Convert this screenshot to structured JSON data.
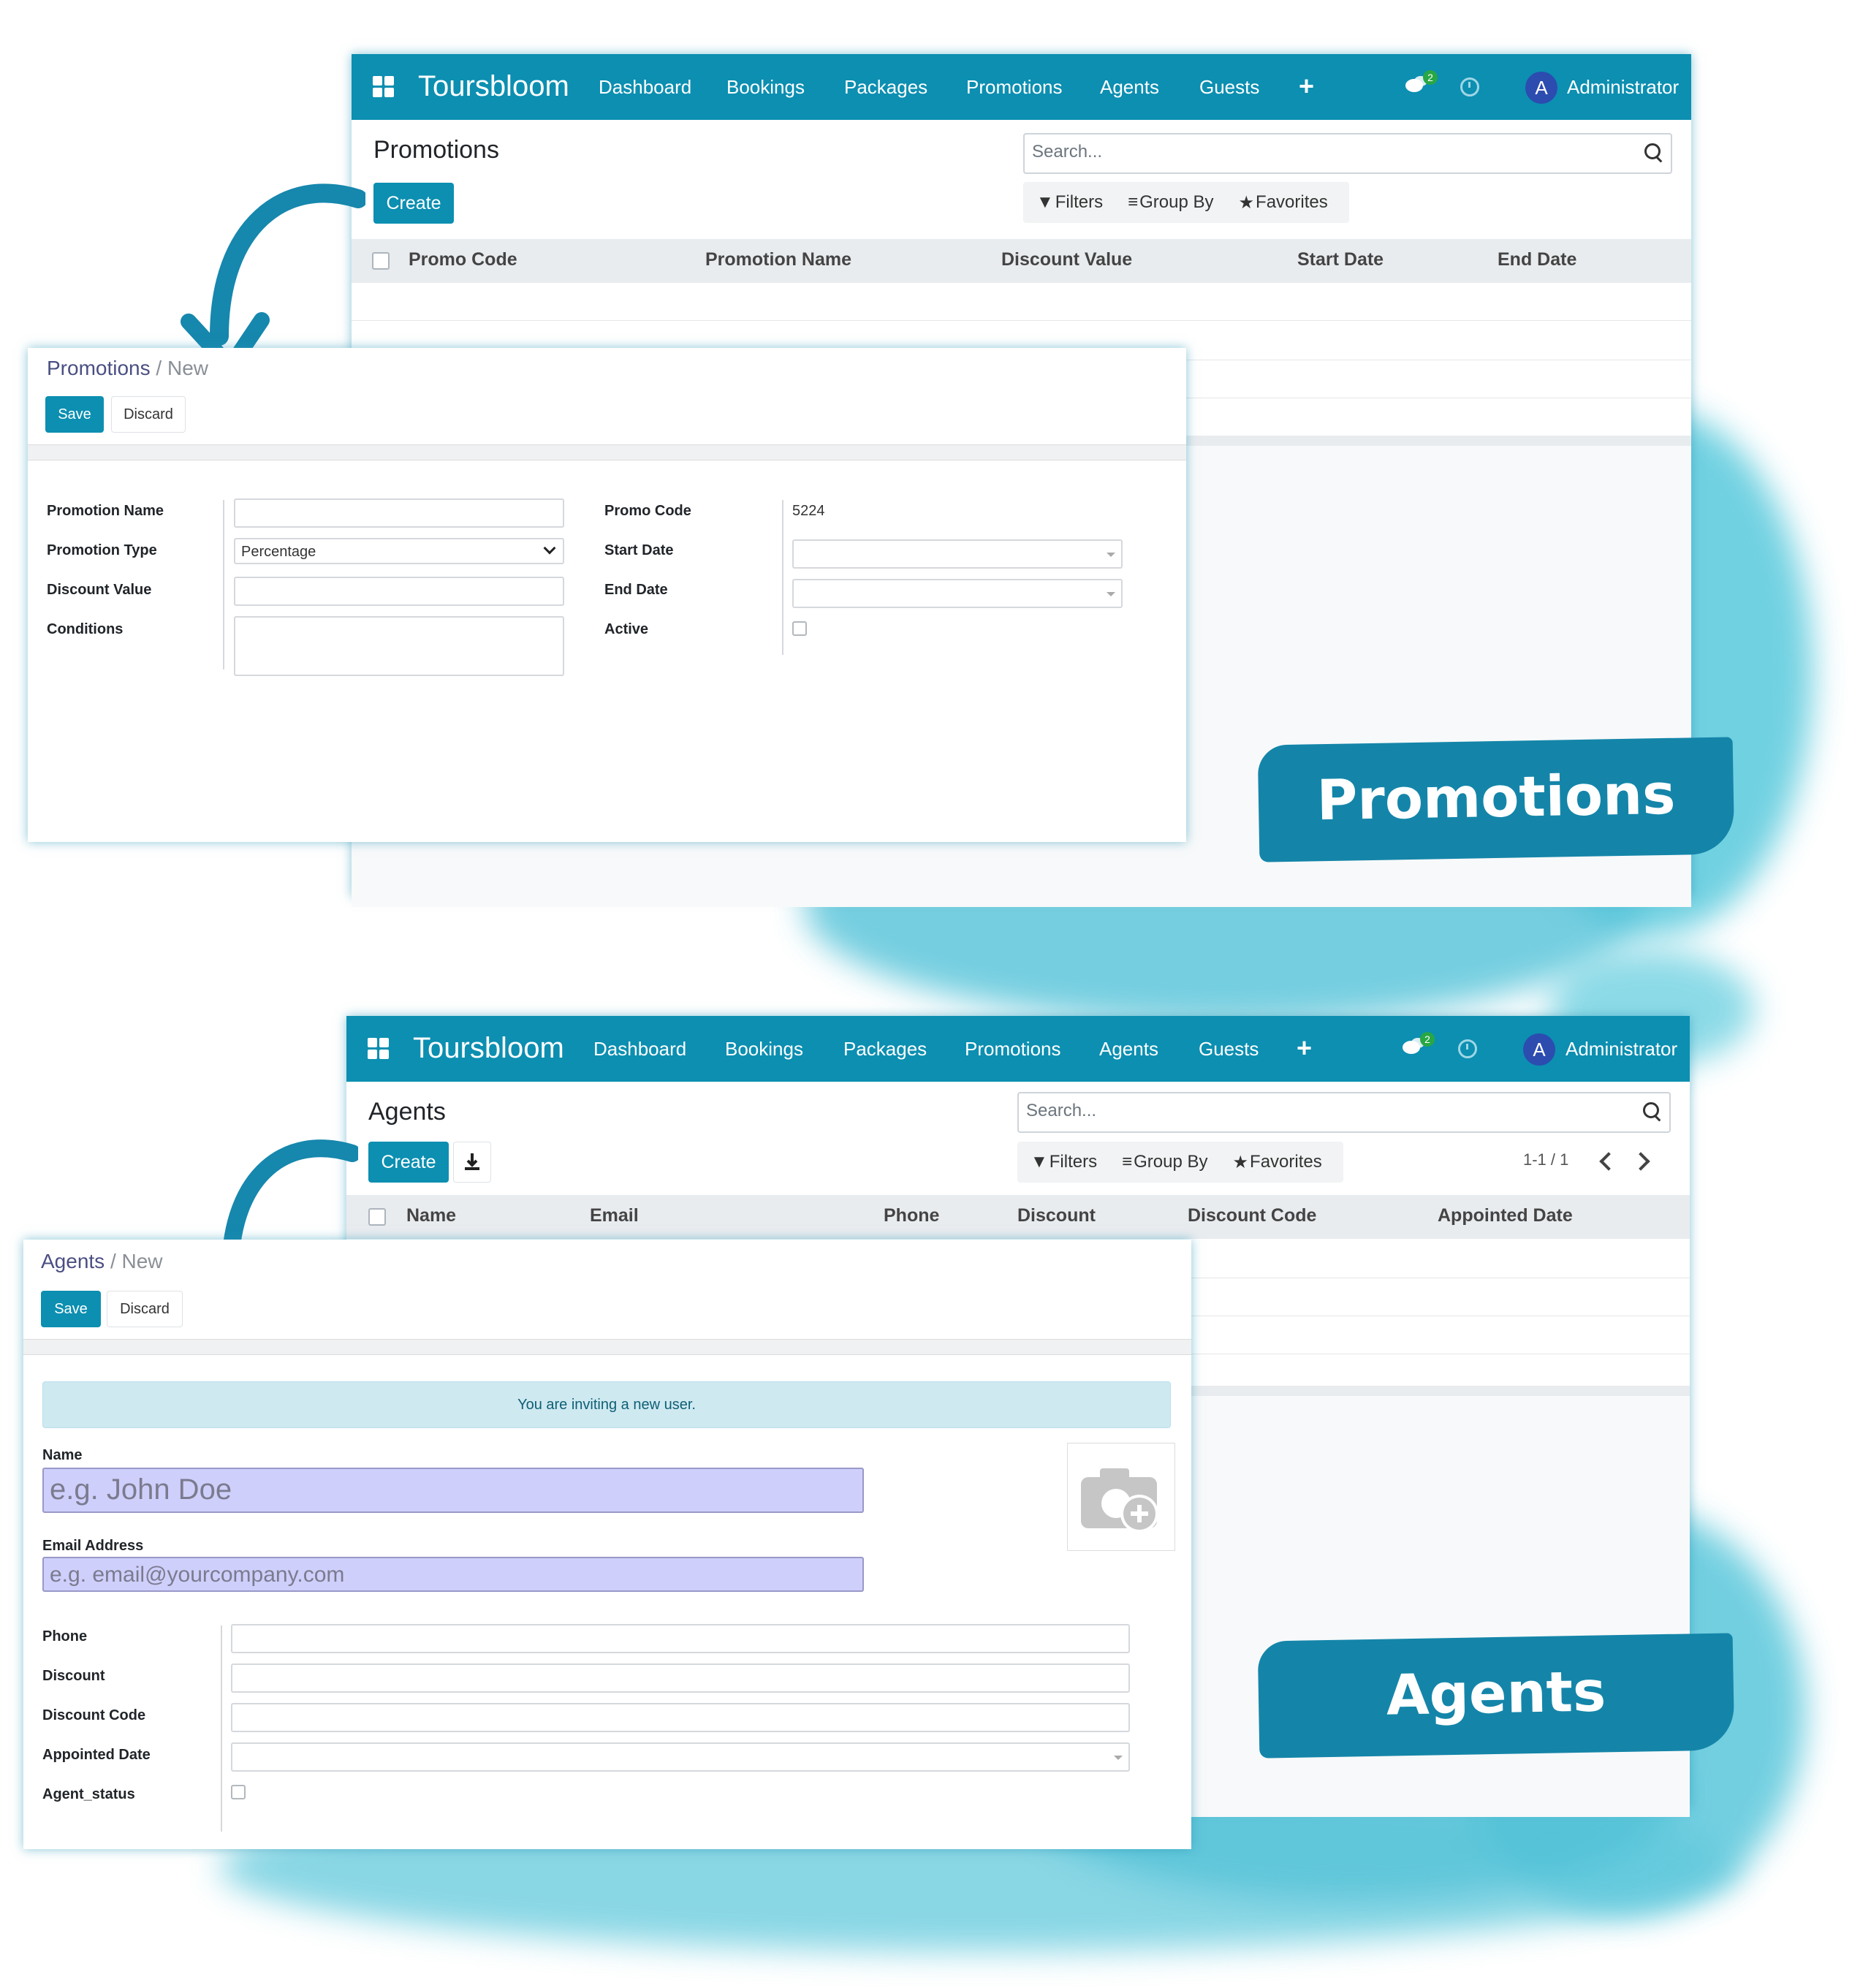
{
  "colors": {
    "brand": "#0c8fb1",
    "banner": "#1485a9",
    "splash": "#4cc6da"
  },
  "app": {
    "name": "Toursbloom",
    "nav_items": [
      "Dashboard",
      "Bookings",
      "Packages",
      "Promotions",
      "Agents",
      "Guests"
    ],
    "chat_count": "2",
    "avatar_initial": "A",
    "user": "Administrator"
  },
  "search": {
    "placeholder": "Search..."
  },
  "filters": {
    "filters": "Filters",
    "group_by": "Group By",
    "favorites": "Favorites"
  },
  "promotions_list": {
    "title": "Promotions",
    "create": "Create",
    "columns": [
      "Promo Code",
      "Promotion Name",
      "Discount Value",
      "Start Date",
      "End Date"
    ]
  },
  "promotion_form": {
    "breadcrumb_parent": "Promotions",
    "breadcrumb_sep": "/",
    "breadcrumb_current": "New",
    "save": "Save",
    "discard": "Discard",
    "labels": {
      "promotion_name": "Promotion Name",
      "promotion_type": "Promotion Type",
      "discount_value": "Discount Value",
      "conditions": "Conditions",
      "promo_code": "Promo Code",
      "start_date": "Start Date",
      "end_date": "End Date",
      "active": "Active"
    },
    "values": {
      "promotion_type": "Percentage",
      "promo_code": "5224"
    }
  },
  "agents_list": {
    "title": "Agents",
    "create": "Create",
    "pager": "1-1 / 1",
    "columns": [
      "Name",
      "Email",
      "Phone",
      "Discount",
      "Discount Code",
      "Appointed Date"
    ]
  },
  "agent_form": {
    "breadcrumb_parent": "Agents",
    "breadcrumb_sep": "/",
    "breadcrumb_current": "New",
    "save": "Save",
    "discard": "Discard",
    "alert": "You are inviting a new user.",
    "labels": {
      "name": "Name",
      "email": "Email Address",
      "phone": "Phone",
      "discount": "Discount",
      "discount_code": "Discount Code",
      "appointed_date": "Appointed Date",
      "agent_status": "Agent_status"
    },
    "placeholders": {
      "name": "e.g. John Doe",
      "email": "e.g. email@yourcompany.com"
    }
  },
  "banners": {
    "promotions": "Promotions",
    "agents": "Agents"
  }
}
